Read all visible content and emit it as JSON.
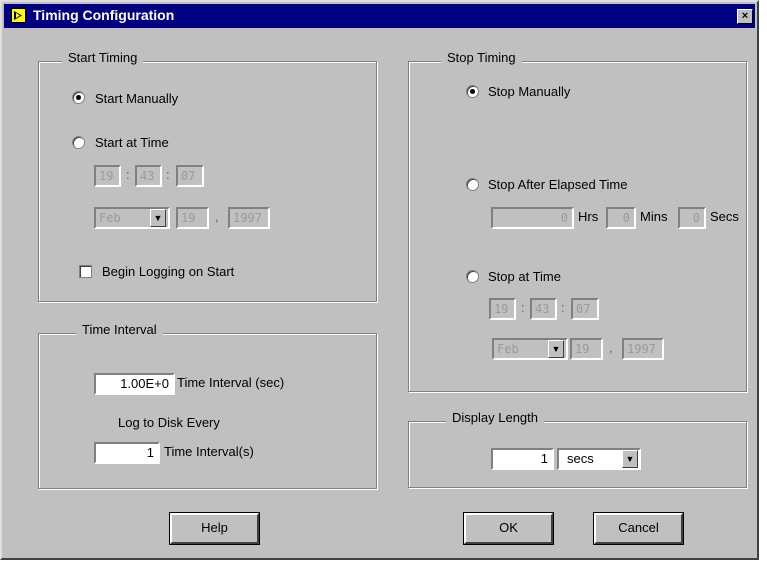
{
  "window": {
    "title": "Timing Configuration",
    "close": "×"
  },
  "start_timing": {
    "group_title": "Start Timing",
    "start_manually": "Start Manually",
    "start_at_time": "Start at Time",
    "hour": "19",
    "minute": "43",
    "second": "07",
    "month": "Feb",
    "day": "19",
    "year": "1997",
    "begin_logging": "Begin Logging on Start",
    "selected": "start_manually",
    "begin_logging_checked": false
  },
  "time_interval": {
    "group_title": "Time Interval",
    "interval_value": "1.00E+0",
    "interval_label": "Time Interval (sec)",
    "log_label": "Log to Disk Every",
    "log_value": "1",
    "log_unit": "Time Interval(s)"
  },
  "stop_timing": {
    "group_title": "Stop Timing",
    "stop_manually": "Stop Manually",
    "stop_after": "Stop After Elapsed Time",
    "hrs_value": "0",
    "hrs_label": "Hrs",
    "mins_value": "0",
    "mins_label": "Mins",
    "secs_value": "0",
    "secs_label": "Secs",
    "stop_at_time": "Stop at Time",
    "hour": "19",
    "minute": "43",
    "second": "07",
    "month": "Feb",
    "day": "19",
    "year": "1997",
    "selected": "stop_manually"
  },
  "display_length": {
    "group_title": "Display Length",
    "value": "1",
    "unit": "secs"
  },
  "buttons": {
    "help": "Help",
    "ok": "OK",
    "cancel": "Cancel"
  },
  "separators": {
    "colon": ":",
    "comma": ","
  },
  "icons": {
    "dropdown": "▼"
  }
}
